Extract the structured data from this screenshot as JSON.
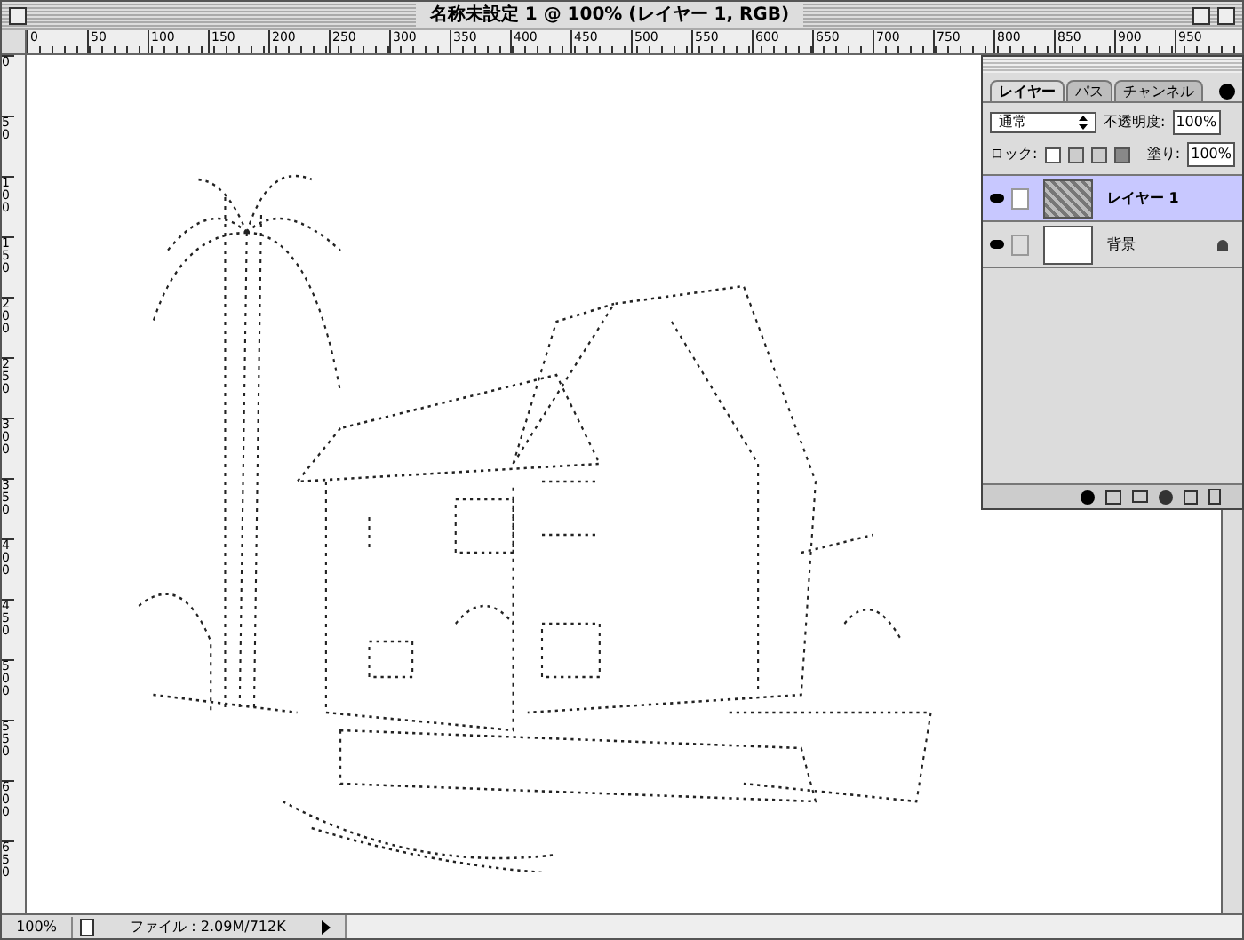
{
  "window": {
    "title": "名称未設定 1 @ 100% (レイヤー 1, RGB)"
  },
  "ruler": {
    "horizontal": [
      "0",
      "50",
      "100",
      "150",
      "200",
      "250",
      "300",
      "350",
      "400",
      "450",
      "500",
      "550",
      "600",
      "650",
      "700",
      "750",
      "800",
      "850",
      "900",
      "950"
    ],
    "vertical": [
      "0",
      "50",
      "100",
      "150",
      "200",
      "250",
      "300",
      "350",
      "400",
      "450",
      "500",
      "550",
      "600",
      "650"
    ]
  },
  "layers_panel": {
    "tabs": [
      {
        "label": "レイヤー",
        "selected": true
      },
      {
        "label": "パス",
        "selected": false
      },
      {
        "label": "チャンネル",
        "selected": false
      }
    ],
    "blend_mode": "通常",
    "opacity_label": "不透明度:",
    "opacity": "100%",
    "lock_label": "ロック:",
    "fill_label": "塗り:",
    "fill": "100%",
    "layers": [
      {
        "name": "レイヤー 1",
        "selected": true,
        "visible": true,
        "locked": false,
        "kind": "pattern"
      },
      {
        "name": "背景",
        "selected": false,
        "visible": true,
        "locked": true,
        "kind": "plain"
      }
    ]
  },
  "status_bar": {
    "zoom": "100%",
    "info": "ファイル : 2.09M/712K"
  }
}
